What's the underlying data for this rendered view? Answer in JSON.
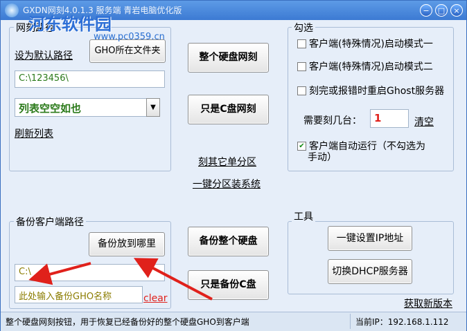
{
  "window": {
    "title": "GXDN网刻4.0.1.3 服务端  青岩电脑优化版",
    "watermark": "河东软件园",
    "watermark_url": "www.pc0359.cn",
    "controls": {
      "minimize": "−",
      "maximize": "□",
      "close": "×"
    }
  },
  "path_group": {
    "label": "网刻路径",
    "set_default_link": "设为默认路径",
    "gho_folder_button": "GHO所在文件夹",
    "path_value": "C:\\123456\\",
    "list_value": "列表空空如也",
    "refresh_link": "刷新列表"
  },
  "center": {
    "clone_disk_button": "整个硬盘网刻",
    "clone_c_button": "只是C盘网刻",
    "other_partition_link": "刻其它单分区",
    "one_click_link": "一键分区装系统",
    "backup_disk_button": "备份整个硬盘",
    "backup_c_button": "只是备份C盘"
  },
  "check_group": {
    "label": "勾选",
    "option1": "客户端(特殊情况)启动模式一",
    "option2": "客户端(特殊情况)启动模式二",
    "option3": "刻完或报错时重启Ghost服务器",
    "count_label": "需要刻几台：",
    "count_value": "1",
    "clear_link": "清空",
    "autorun_line1": "客户端自动运行（不勾选为",
    "autorun_line2": "手动）",
    "autorun_checked": true
  },
  "backup_group": {
    "label": "备份客户端路径",
    "where_button": "备份放到哪里",
    "path_value": "C:\\",
    "name_placeholder": "此处输入备份GHO名称",
    "clear_link": "clear"
  },
  "tools_group": {
    "label": "工具",
    "set_ip_button": "一键设置IP地址",
    "dhcp_button": "切换DHCP服务器"
  },
  "update_link": "获取新版本",
  "status": {
    "hint": "整个硬盘网刻按钮，用于恢复已经备份好的整个硬盘GHO到客户端",
    "ip": "当前IP：192.168.1.112"
  },
  "colors": {
    "annotation_arrow": "#e0211b",
    "accent": "#3c7ad3"
  }
}
